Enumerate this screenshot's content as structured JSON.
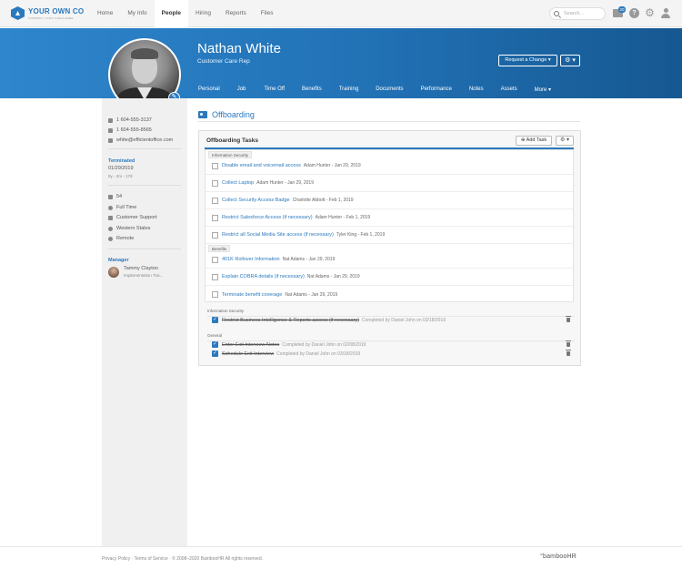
{
  "brand": {
    "name": "YOUR OWN CO",
    "tagline": "COMPANY LOGO GOES HERE",
    "accent": "#2b79bd"
  },
  "topnav": {
    "links": [
      "Home",
      "My Info",
      "People",
      "Hiring",
      "Reports",
      "Files"
    ],
    "active": "People",
    "search_placeholder": "Search...",
    "inbox_count": "20",
    "help_label": "?"
  },
  "profile": {
    "name": "Nathan White",
    "title": "Customer Care Rep",
    "request_change_label": "Request a Change ▾",
    "gear_label": "⚙ ▾",
    "tabs": [
      "Personal",
      "Job",
      "Time Off",
      "Benefits",
      "Training",
      "Documents",
      "Performance",
      "Notes",
      "Assets",
      "More ▾"
    ]
  },
  "sidebar": {
    "work_phone": "1 604-555-3137",
    "mobile_phone": "1 604-555-8565",
    "email": "white@efficientoffice.com",
    "terminated_label": "Terminated",
    "terminated_date": "01/29/2019",
    "tenure": "5y - 2m - 17d",
    "employee_number": "54",
    "employment_type": "Full Time",
    "department": "Customer Support",
    "division": "Western States",
    "location": "Remote",
    "manager_label": "Manager",
    "manager_name": "Tammy Clayton",
    "manager_title": "Implementation Trai..."
  },
  "section": {
    "title": "Offboarding"
  },
  "panel": {
    "title": "Offboarding Tasks",
    "add_task_label": "Add Task",
    "gear_label": "⚙ ▾",
    "groups": [
      {
        "name": "Information Security",
        "tasks": [
          {
            "label": "Disable email and voicemail access",
            "meta": "Adam Hunter - Jan 29, 2019"
          },
          {
            "label": "Collect Laptop",
            "meta": "Adam Hunter - Jan 29, 2019"
          },
          {
            "label": "Collect Security Access Badge",
            "meta": "Charlotte Abbott - Feb 1, 2019"
          },
          {
            "label": "Restrict Salesforce Access (if necessary)",
            "meta": "Adam Hunter - Feb 1, 2019"
          },
          {
            "label": "Restrict all Social Media Site access (if necessary)",
            "meta": "Tyler King - Feb 1, 2019"
          }
        ]
      },
      {
        "name": "Benefits",
        "tasks": [
          {
            "label": "401K Rollover Information",
            "meta": "Nat Adams - Jan 29, 2019"
          },
          {
            "label": "Explain COBRA details (if necessary)",
            "meta": "Nat Adams - Jan 29, 2019"
          },
          {
            "label": "Terminate benefit coverage",
            "meta": "Nat Adams - Jan 29, 2019"
          }
        ]
      }
    ],
    "completed_groups": [
      {
        "name": "Information Security",
        "tasks": [
          {
            "label": "Restrict Business Intelligence & Reports access (if necessary)",
            "meta": "Completed by Daniel John on 03/18/2019"
          }
        ]
      },
      {
        "name": "General",
        "tasks": [
          {
            "label": "Enter Exit Interview Notes",
            "meta": "Completed by Daniel John on 02/08/2019"
          },
          {
            "label": "Schedule Exit Interview",
            "meta": "Completed by Daniel John on 03/18/2019"
          }
        ]
      }
    ]
  },
  "footer": {
    "text": "Privacy Policy  ·  Terms of Service  ·  © 2008–2020 BambooHR All rights reserved.",
    "logo": "°bambooHR"
  }
}
